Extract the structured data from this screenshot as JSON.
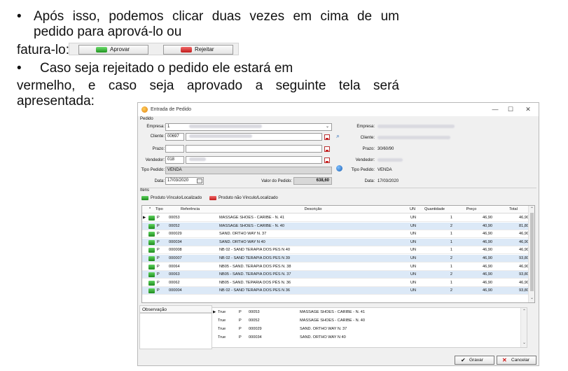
{
  "slide": {
    "bullet": "•",
    "b1_line1": "Após isso, podemos clicar duas vezes em cima de um",
    "b1_line2": "pedido para aprová-lo ou",
    "fatura": "fatura-lo:",
    "btn_aprovar": "Aprovar",
    "btn_rejeitar": "Rejeitar",
    "b2": "Caso seja rejeitado o pedido ele estará em",
    "b3_line1": "vermelho, e caso seja aprovado a seguinte tela será",
    "b3_line2": "apresentada:"
  },
  "window": {
    "title": "Entrada de Pedido",
    "controls": [
      "—",
      "☐",
      "✕"
    ]
  },
  "pedido": {
    "section": "Pedido",
    "empresa_label": "Empresa:",
    "empresa_value": "1",
    "cliente_label": "Cliente:",
    "cliente_value": "00697",
    "prazo_label": "Prazo:",
    "vendedor_label": "Vendedor:",
    "vendedor_value": "018",
    "tipo_label": "Tipo Pedido:",
    "tipo_value": "VENDA",
    "data_label": "Data:",
    "data_value": "17/03/2020",
    "valor_label": "Valor do Pedido:",
    "valor_value": "638,60"
  },
  "resumo": {
    "empresa_label": "Empresa:",
    "cliente_label": "Cliente:",
    "prazo_label": "Prazo:",
    "prazo_value": "30/60/90",
    "vendedor_label": "Vendedor:",
    "tipo_label": "Tipo Pedido:",
    "tipo_value": "VENDA",
    "data_label": "Data:",
    "data_value": "17/03/2020"
  },
  "itens": {
    "section": "Itens",
    "legend_ok": "Produto Vínculo/Localizado",
    "legend_bad": "Produto não Vínculo/Localizado",
    "columns": [
      "Tipo",
      "Referência",
      "Descrição",
      "UN",
      "Quantidade",
      "Preço",
      "Total"
    ],
    "rows": [
      {
        "tipo": "P",
        "ref": "00053",
        "desc": "MASSAGE SHOES - CARIBE - N. 41",
        "un": "UN",
        "qtd": "1",
        "preco": "46,90",
        "total": "46,90"
      },
      {
        "tipo": "P",
        "ref": "00052",
        "desc": "MASSAGE SHOES - CARIBE - N. 40",
        "un": "UN",
        "qtd": "2",
        "preco": "40,90",
        "total": "81,80"
      },
      {
        "tipo": "P",
        "ref": "000029",
        "desc": "SAND. ORTHO WAY N. 37",
        "un": "UN",
        "qtd": "1",
        "preco": "46,90",
        "total": "46,90"
      },
      {
        "tipo": "P",
        "ref": "000034",
        "desc": "SAND. ORTHO WAY N 40",
        "un": "UN",
        "qtd": "1",
        "preco": "46,90",
        "total": "46,90"
      },
      {
        "tipo": "P",
        "ref": "000008",
        "desc": "NB 02 - SAND TERAPIA DOS PES N 40",
        "un": "UN",
        "qtd": "1",
        "preco": "46,90",
        "total": "46,90"
      },
      {
        "tipo": "P",
        "ref": "000007",
        "desc": "NB 02 - SAND TERAPIA DOS PES N 39",
        "un": "UN",
        "qtd": "2",
        "preco": "46,90",
        "total": "93,80"
      },
      {
        "tipo": "P",
        "ref": "00064",
        "desc": "NB05 - SAND. TERAPIA DOS PÉS N. 38",
        "un": "UN",
        "qtd": "1",
        "preco": "46,90",
        "total": "46,90"
      },
      {
        "tipo": "P",
        "ref": "00063",
        "desc": "NB05 - SAND. TERAPIA DOS PÉS N. 37",
        "un": "UN",
        "qtd": "2",
        "preco": "46,90",
        "total": "93,80"
      },
      {
        "tipo": "P",
        "ref": "00062",
        "desc": "NB05 - SAND. TEPARIA DOS PÉS N. 36",
        "un": "UN",
        "qtd": "1",
        "preco": "46,90",
        "total": "46,90"
      },
      {
        "tipo": "P",
        "ref": "000004",
        "desc": "NB 02 - SAND TERAPIA DOS PES N 36",
        "un": "UN",
        "qtd": "2",
        "preco": "46,90",
        "total": "93,80"
      }
    ]
  },
  "observacao": {
    "label": "Observação",
    "rows": [
      {
        "flag": "True",
        "tipo": "P",
        "ref": "00053",
        "desc": "MASSAGE SHOES - CARIBE - N. 41"
      },
      {
        "flag": "True",
        "tipo": "P",
        "ref": "00052",
        "desc": "MASSAGE SHOES - CARIBE - N. 40"
      },
      {
        "flag": "True",
        "tipo": "P",
        "ref": "000029",
        "desc": "SAND. ORTHO WAY N. 37"
      },
      {
        "flag": "True",
        "tipo": "P",
        "ref": "000034",
        "desc": "SAND. ORTHO WAY N 40"
      }
    ]
  },
  "buttons": {
    "gravar": "Gravar",
    "cancelar": "Cancelar"
  },
  "colors": {
    "approve": "#2aa52a",
    "reject": "#d42a2a",
    "row_alt": "#dce9f7"
  }
}
